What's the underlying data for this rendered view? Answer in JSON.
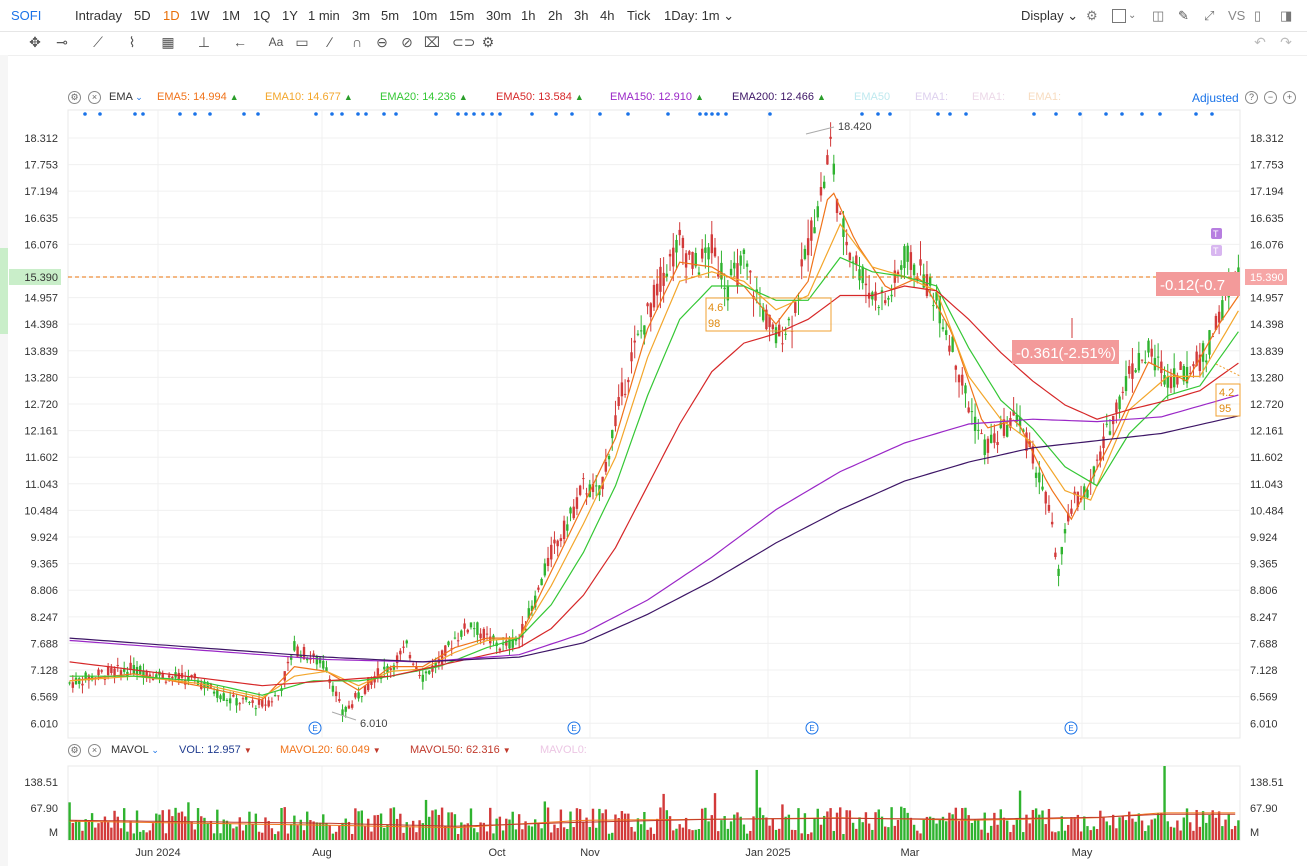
{
  "topbar": {
    "symbol": "SOFI",
    "periods": [
      "Intraday",
      "5D",
      "1D",
      "1W",
      "1M",
      "1Q",
      "1Y",
      "1 min",
      "3m",
      "5m",
      "10m",
      "15m",
      "30m",
      "1h",
      "2h",
      "3h",
      "4h",
      "Tick"
    ],
    "active_period": "1D",
    "range_select": "1Day: 1m",
    "display_label": "Display",
    "vs_label": "VS",
    "accent_color": "#e8700a",
    "link_color": "#1a73e8"
  },
  "toolbar_icons": [
    "move-icon",
    "line-tool-icon",
    "channel-tool-icon",
    "wave-tool-icon",
    "fib-tool-icon",
    "measure-tool-icon",
    "arrow-tool-icon",
    "text-tool-icon",
    "note-tool-icon",
    "pen-tool-icon",
    "arc-tool-icon",
    "magnet-icon",
    "hide-icon",
    "trash-icon",
    "link-icon",
    "settings-icon",
    "undo-icon",
    "redo-icon"
  ],
  "ema_legend": {
    "name": "EMA",
    "items": [
      {
        "label": "EMA5:",
        "value": "14.994",
        "color": "#f0731a",
        "arrow": "▲"
      },
      {
        "label": "EMA10:",
        "value": "14.677",
        "color": "#f3a62b",
        "arrow": "▲"
      },
      {
        "label": "EMA20:",
        "value": "14.236",
        "color": "#34c734",
        "arrow": "▲"
      },
      {
        "label": "EMA50:",
        "value": "13.584",
        "color": "#d62728",
        "arrow": "▲"
      },
      {
        "label": "EMA150:",
        "value": "12.910",
        "color": "#9a27c7",
        "arrow": "▲"
      },
      {
        "label": "EMA200:",
        "value": "12.466",
        "color": "#3d1566",
        "arrow": "▲"
      }
    ],
    "faded": [
      "EMA50",
      "EMA1:",
      "EMA1:",
      "EMA1:"
    ],
    "adjusted_label": "Adjusted"
  },
  "vol_legend": {
    "name": "MAVOL",
    "items": [
      {
        "label": "VOL:",
        "value": "12.957",
        "color": "#1f3b8f"
      },
      {
        "label": "MAVOL20:",
        "value": "60.049",
        "color": "#f0731a"
      },
      {
        "label": "MAVOL50:",
        "value": "62.316",
        "color": "#c0392b"
      }
    ],
    "faded": "MAVOL0:"
  },
  "chart_data": {
    "type": "candlestick",
    "symbol": "SOFI",
    "price_axis_ticks": [
      "18.312",
      "17.753",
      "17.194",
      "16.635",
      "16.076",
      "15.390",
      "14.957",
      "14.398",
      "13.839",
      "13.280",
      "12.720",
      "12.161",
      "11.602",
      "11.043",
      "10.484",
      "9.924",
      "9.365",
      "8.806",
      "8.247",
      "7.688",
      "7.128",
      "6.569",
      "6.010"
    ],
    "ylim": [
      5.7,
      18.9
    ],
    "last_price": "15.390",
    "last_price_value": 15.39,
    "time_axis_labels": [
      "Jun 2024",
      "Aug",
      "Oct",
      "Nov",
      "Jan 2025",
      "Mar",
      "May"
    ],
    "high_label": "18.420",
    "low_label": "6.010",
    "annotations": {
      "change_top": "-0.12(-0.7",
      "change_mid": "-0.361(-2.51%)",
      "box_left_top": "4.6",
      "box_left_bottom": "98",
      "box_right_top": "4.2",
      "box_right_bottom": "95",
      "marker": "T",
      "event": "E"
    },
    "close_path": [
      [
        0,
        6.85
      ],
      [
        10,
        7.05
      ],
      [
        20,
        7.15
      ],
      [
        30,
        7.0
      ],
      [
        40,
        6.9
      ],
      [
        50,
        6.5
      ],
      [
        60,
        6.4
      ],
      [
        65,
        6.6
      ],
      [
        70,
        7.6
      ],
      [
        75,
        7.4
      ],
      [
        80,
        7.2
      ],
      [
        85,
        6.2
      ],
      [
        90,
        6.6
      ],
      [
        95,
        7.0
      ],
      [
        100,
        7.2
      ],
      [
        105,
        7.6
      ],
      [
        110,
        7.0
      ],
      [
        115,
        7.3
      ],
      [
        120,
        7.8
      ],
      [
        125,
        8.1
      ],
      [
        130,
        7.8
      ],
      [
        135,
        7.6
      ],
      [
        140,
        7.8
      ],
      [
        145,
        8.6
      ],
      [
        150,
        9.6
      ],
      [
        155,
        10.2
      ],
      [
        160,
        11.0
      ],
      [
        165,
        10.8
      ],
      [
        170,
        12.4
      ],
      [
        175,
        13.7
      ],
      [
        180,
        14.6
      ],
      [
        185,
        15.5
      ],
      [
        190,
        16.1
      ],
      [
        195,
        15.6
      ],
      [
        200,
        16.0
      ],
      [
        205,
        15.2
      ],
      [
        210,
        15.7
      ],
      [
        215,
        14.8
      ],
      [
        220,
        14.1
      ],
      [
        225,
        14.5
      ],
      [
        230,
        16.1
      ],
      [
        235,
        17.4
      ],
      [
        237,
        18.2
      ],
      [
        240,
        16.5
      ],
      [
        245,
        15.7
      ],
      [
        250,
        15.0
      ],
      [
        255,
        14.9
      ],
      [
        260,
        15.8
      ],
      [
        265,
        15.5
      ],
      [
        270,
        14.9
      ],
      [
        275,
        13.9
      ],
      [
        280,
        12.7
      ],
      [
        285,
        11.8
      ],
      [
        290,
        12.1
      ],
      [
        295,
        12.5
      ],
      [
        300,
        11.6
      ],
      [
        305,
        10.5
      ],
      [
        308,
        9.2
      ],
      [
        312,
        10.6
      ],
      [
        318,
        11.0
      ],
      [
        324,
        12.3
      ],
      [
        330,
        13.4
      ],
      [
        336,
        13.8
      ],
      [
        342,
        13.3
      ],
      [
        348,
        13.4
      ],
      [
        354,
        13.8
      ],
      [
        358,
        14.6
      ],
      [
        362,
        15.2
      ],
      [
        364,
        15.39
      ]
    ],
    "ema_series": [
      {
        "name": "EMA5",
        "color": "#f0731a",
        "pts": [
          [
            0,
            6.9
          ],
          [
            20,
            7.05
          ],
          [
            40,
            6.8
          ],
          [
            60,
            6.5
          ],
          [
            70,
            7.2
          ],
          [
            80,
            7.1
          ],
          [
            90,
            6.7
          ],
          [
            100,
            7.2
          ],
          [
            110,
            7.2
          ],
          [
            120,
            7.6
          ],
          [
            130,
            7.8
          ],
          [
            140,
            7.8
          ],
          [
            150,
            9.2
          ],
          [
            160,
            10.6
          ],
          [
            170,
            12.0
          ],
          [
            180,
            14.3
          ],
          [
            190,
            15.7
          ],
          [
            200,
            15.6
          ],
          [
            210,
            15.2
          ],
          [
            220,
            14.4
          ],
          [
            230,
            15.3
          ],
          [
            237,
            17.3
          ],
          [
            245,
            16.1
          ],
          [
            255,
            15.1
          ],
          [
            265,
            15.4
          ],
          [
            275,
            14.2
          ],
          [
            285,
            12.2
          ],
          [
            295,
            12.4
          ],
          [
            305,
            11.0
          ],
          [
            312,
            10.3
          ],
          [
            324,
            11.9
          ],
          [
            336,
            13.6
          ],
          [
            348,
            13.2
          ],
          [
            358,
            14.4
          ],
          [
            364,
            14.99
          ]
        ]
      },
      {
        "name": "EMA10",
        "color": "#f3a62b",
        "pts": [
          [
            0,
            6.9
          ],
          [
            20,
            7.0
          ],
          [
            40,
            6.85
          ],
          [
            60,
            6.55
          ],
          [
            70,
            7.0
          ],
          [
            80,
            7.1
          ],
          [
            90,
            6.8
          ],
          [
            100,
            7.1
          ],
          [
            110,
            7.15
          ],
          [
            120,
            7.5
          ],
          [
            130,
            7.75
          ],
          [
            140,
            7.8
          ],
          [
            150,
            8.9
          ],
          [
            160,
            10.2
          ],
          [
            170,
            11.6
          ],
          [
            180,
            13.7
          ],
          [
            190,
            15.3
          ],
          [
            200,
            15.5
          ],
          [
            210,
            15.3
          ],
          [
            220,
            14.7
          ],
          [
            230,
            15.0
          ],
          [
            240,
            16.5
          ],
          [
            250,
            15.6
          ],
          [
            260,
            15.4
          ],
          [
            270,
            15.1
          ],
          [
            280,
            13.3
          ],
          [
            290,
            12.4
          ],
          [
            300,
            11.9
          ],
          [
            310,
            10.9
          ],
          [
            318,
            10.7
          ],
          [
            330,
            12.6
          ],
          [
            342,
            13.3
          ],
          [
            352,
            13.3
          ],
          [
            364,
            14.68
          ]
        ]
      },
      {
        "name": "EMA20",
        "color": "#34c734",
        "pts": [
          [
            0,
            7.0
          ],
          [
            20,
            7.0
          ],
          [
            40,
            6.9
          ],
          [
            60,
            6.6
          ],
          [
            75,
            6.9
          ],
          [
            90,
            6.9
          ],
          [
            100,
            7.0
          ],
          [
            115,
            7.2
          ],
          [
            130,
            7.6
          ],
          [
            140,
            7.8
          ],
          [
            150,
            8.5
          ],
          [
            160,
            9.6
          ],
          [
            170,
            11.0
          ],
          [
            180,
            12.9
          ],
          [
            190,
            14.5
          ],
          [
            200,
            15.2
          ],
          [
            210,
            15.2
          ],
          [
            220,
            14.9
          ],
          [
            230,
            14.9
          ],
          [
            240,
            15.8
          ],
          [
            250,
            15.5
          ],
          [
            260,
            15.4
          ],
          [
            270,
            15.2
          ],
          [
            280,
            13.9
          ],
          [
            290,
            12.8
          ],
          [
            300,
            12.2
          ],
          [
            310,
            11.4
          ],
          [
            320,
            11.0
          ],
          [
            330,
            12.1
          ],
          [
            342,
            12.9
          ],
          [
            352,
            13.1
          ],
          [
            364,
            14.24
          ]
        ]
      },
      {
        "name": "EMA50",
        "color": "#d62728",
        "pts": [
          [
            0,
            7.3
          ],
          [
            30,
            7.05
          ],
          [
            60,
            6.8
          ],
          [
            80,
            6.9
          ],
          [
            100,
            7.0
          ],
          [
            120,
            7.3
          ],
          [
            140,
            7.6
          ],
          [
            150,
            8.0
          ],
          [
            160,
            8.7
          ],
          [
            170,
            9.7
          ],
          [
            180,
            11.0
          ],
          [
            190,
            12.3
          ],
          [
            200,
            13.4
          ],
          [
            210,
            14.0
          ],
          [
            220,
            14.2
          ],
          [
            230,
            14.5
          ],
          [
            240,
            15.0
          ],
          [
            250,
            15.0
          ],
          [
            260,
            15.2
          ],
          [
            270,
            15.1
          ],
          [
            280,
            14.5
          ],
          [
            290,
            13.8
          ],
          [
            300,
            13.2
          ],
          [
            310,
            12.7
          ],
          [
            320,
            12.4
          ],
          [
            330,
            12.6
          ],
          [
            342,
            12.8
          ],
          [
            352,
            13.0
          ],
          [
            364,
            13.58
          ]
        ]
      },
      {
        "name": "EMA150",
        "color": "#9a27c7",
        "pts": [
          [
            0,
            7.75
          ],
          [
            40,
            7.55
          ],
          [
            80,
            7.35
          ],
          [
            110,
            7.3
          ],
          [
            140,
            7.45
          ],
          [
            160,
            7.9
          ],
          [
            180,
            8.6
          ],
          [
            200,
            9.5
          ],
          [
            220,
            10.5
          ],
          [
            240,
            11.3
          ],
          [
            260,
            11.9
          ],
          [
            280,
            12.3
          ],
          [
            300,
            12.4
          ],
          [
            320,
            12.35
          ],
          [
            340,
            12.45
          ],
          [
            364,
            12.91
          ]
        ]
      },
      {
        "name": "EMA200",
        "color": "#3d1566",
        "pts": [
          [
            0,
            7.8
          ],
          [
            40,
            7.6
          ],
          [
            80,
            7.4
          ],
          [
            110,
            7.3
          ],
          [
            140,
            7.4
          ],
          [
            160,
            7.7
          ],
          [
            180,
            8.3
          ],
          [
            200,
            9.0
          ],
          [
            220,
            9.8
          ],
          [
            240,
            10.5
          ],
          [
            260,
            11.1
          ],
          [
            280,
            11.5
          ],
          [
            300,
            11.8
          ],
          [
            320,
            11.95
          ],
          [
            340,
            12.1
          ],
          [
            364,
            12.47
          ]
        ]
      }
    ],
    "volume_axis_ticks": [
      "138.51",
      "67.90",
      "M"
    ],
    "volume_max": 150,
    "volume_mavol": [
      {
        "name": "MAVOL20",
        "color": "#f0731a",
        "pts": [
          [
            0,
            38
          ],
          [
            80,
            30
          ],
          [
            120,
            25
          ],
          [
            160,
            40
          ],
          [
            200,
            42
          ],
          [
            240,
            45
          ],
          [
            280,
            40
          ],
          [
            320,
            45
          ],
          [
            340,
            55
          ],
          [
            364,
            55
          ]
        ]
      },
      {
        "name": "MAVOL50",
        "color": "#c0392b",
        "pts": [
          [
            0,
            40
          ],
          [
            80,
            34
          ],
          [
            120,
            28
          ],
          [
            160,
            36
          ],
          [
            200,
            42
          ],
          [
            240,
            44
          ],
          [
            280,
            42
          ],
          [
            320,
            46
          ],
          [
            340,
            52
          ],
          [
            364,
            52
          ]
        ]
      }
    ]
  }
}
